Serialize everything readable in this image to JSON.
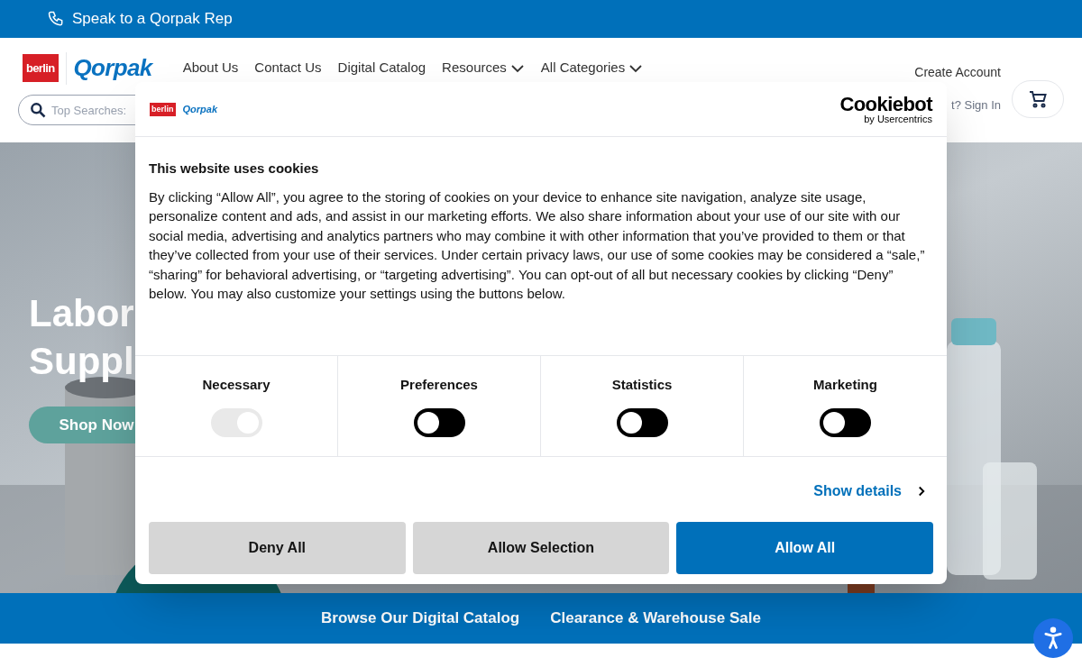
{
  "top_bar": {
    "phone_label": "Speak to a Qorpak Rep"
  },
  "header": {
    "logo": {
      "mark": "berlin",
      "brand": "Qorpak"
    },
    "nav": [
      {
        "label": "About Us",
        "has_menu": false
      },
      {
        "label": "Contact Us",
        "has_menu": false
      },
      {
        "label": "Digital Catalog",
        "has_menu": false
      },
      {
        "label": "Resources",
        "has_menu": true
      },
      {
        "label": "All Categories",
        "has_menu": true
      }
    ],
    "search": {
      "placeholder": "Top Searches:"
    },
    "account": {
      "create": "Create Account",
      "sign_in": "t? Sign In"
    }
  },
  "hero": {
    "title_lines": [
      "Labor",
      "Suppl"
    ],
    "button": "Shop Now"
  },
  "promo_bar": {
    "links": [
      "Browse Our Digital Catalog",
      "Clearance & Warehouse Sale"
    ]
  },
  "cookie_dialog": {
    "site_logo": {
      "mark": "berlin",
      "brand": "Qorpak"
    },
    "provider": {
      "name": "Cookiebot",
      "byline": "by Usercentrics"
    },
    "title": "This website uses cookies",
    "body": "By clicking “Allow All”, you agree to the storing of cookies on your device to enhance site navigation, analyze site usage, personalize content and ads, and assist in our marketing efforts. We also share information about your use of our site with our social media, advertising and analytics partners who may combine it with other information that you’ve provided to them or that they’ve collected from your use of their services. Under certain privacy laws, our use of some cookies may be considered a “sale,” “sharing” for behavioral advertising, or “targeting advertising”. You can opt-out of all but necessary cookies by clicking “Deny” below. You may also customize your settings using the buttons below.",
    "categories": [
      {
        "label": "Necessary",
        "on": true,
        "disabled": true
      },
      {
        "label": "Preferences",
        "on": false,
        "disabled": false
      },
      {
        "label": "Statistics",
        "on": false,
        "disabled": false
      },
      {
        "label": "Marketing",
        "on": false,
        "disabled": false
      }
    ],
    "details_link": "Show details",
    "buttons": [
      {
        "label": "Deny All",
        "kind": "secondary"
      },
      {
        "label": "Allow Selection",
        "kind": "secondary"
      },
      {
        "label": "Allow All",
        "kind": "primary"
      }
    ]
  }
}
